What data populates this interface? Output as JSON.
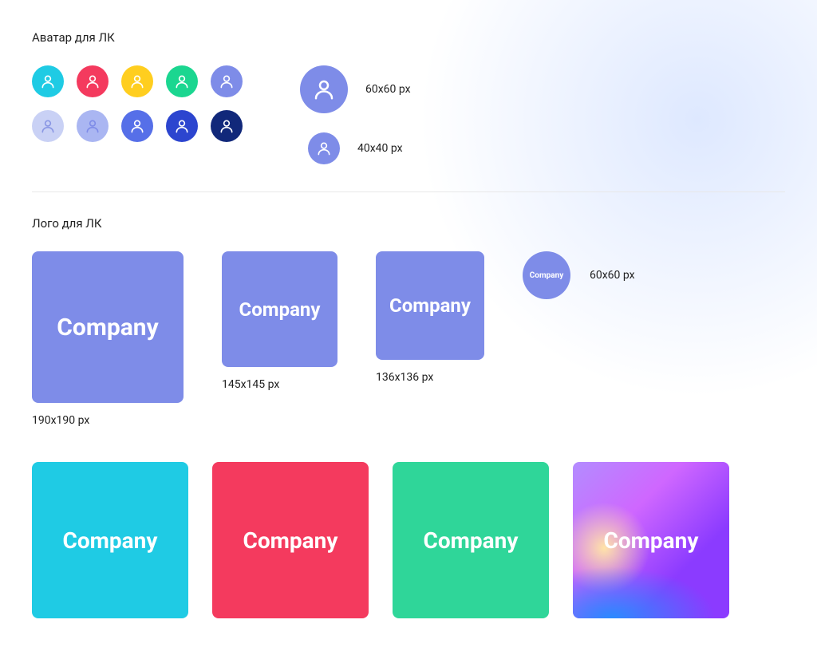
{
  "sections": {
    "avatar": {
      "title": "Аватар для ЛК",
      "swatches_row1": [
        "#1fcbe4",
        "#f43a5e",
        "#ffce1f",
        "#1bd690",
        "#7e8ce8"
      ],
      "swatches_row2": [
        "#c9d1f5",
        "#aab6f2",
        "#566fe8",
        "#2c45cf",
        "#11287a"
      ],
      "row1_icon_colors": [
        "#ffffff",
        "#ffffff",
        "#ffffff",
        "#ffffff",
        "#ffffff"
      ],
      "row2_icon_colors": [
        "#8a97e4",
        "#7e8ce8",
        "#ffffff",
        "#ffffff",
        "#ffffff"
      ],
      "size_60_label": "60x60 px",
      "size_40_label": "40x40 px",
      "sample_color": "#7e8ce8"
    },
    "logo": {
      "title": "Лого для ЛК",
      "company_label": "Company",
      "primary_color": "#7e8ce8",
      "sizes": {
        "s190": "190x190 px",
        "s145": "145x145 px",
        "s136": "136x136 px",
        "s60": "60x60 px"
      },
      "variants": [
        {
          "name": "cyan",
          "color": "#1fcbe4"
        },
        {
          "name": "red",
          "color": "#f43a5e"
        },
        {
          "name": "green",
          "color": "#2fd699"
        },
        {
          "name": "gradient",
          "color": "gradient"
        }
      ]
    }
  }
}
